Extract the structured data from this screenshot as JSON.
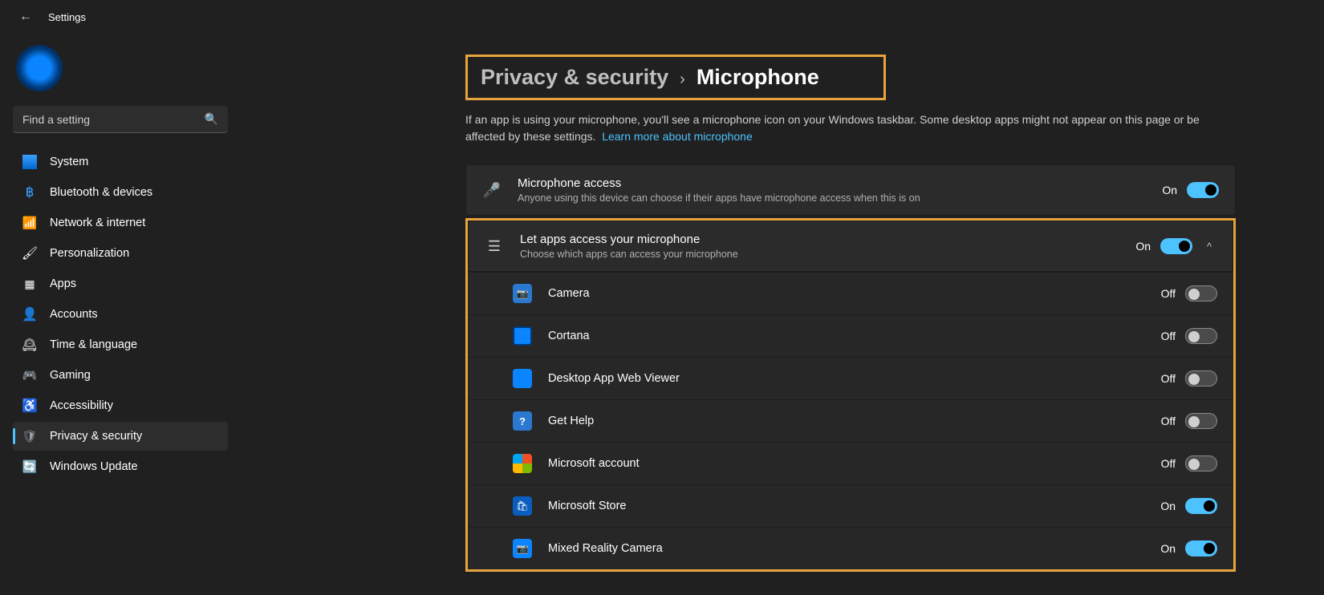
{
  "window": {
    "title": "Settings"
  },
  "search": {
    "placeholder": "Find a setting"
  },
  "sidebar": {
    "items": [
      {
        "label": "System"
      },
      {
        "label": "Bluetooth & devices"
      },
      {
        "label": "Network & internet"
      },
      {
        "label": "Personalization"
      },
      {
        "label": "Apps"
      },
      {
        "label": "Accounts"
      },
      {
        "label": "Time & language"
      },
      {
        "label": "Gaming"
      },
      {
        "label": "Accessibility"
      },
      {
        "label": "Privacy & security"
      },
      {
        "label": "Windows Update"
      }
    ]
  },
  "breadcrumb": {
    "parent": "Privacy & security",
    "current": "Microphone"
  },
  "intro": {
    "text": "If an app is using your microphone, you'll see a microphone icon on your Windows taskbar. Some desktop apps might not appear on this page or be affected by these settings.",
    "link": "Learn more about microphone"
  },
  "mic_access": {
    "title": "Microphone access",
    "subtitle": "Anyone using this device can choose if their apps have microphone access when this is on",
    "state_label": "On",
    "state": "on"
  },
  "apps_access": {
    "title": "Let apps access your microphone",
    "subtitle": "Choose which apps can access your microphone",
    "state_label": "On",
    "state": "on"
  },
  "apps": [
    {
      "name": "Camera",
      "state_label": "Off",
      "state": "off",
      "icon": "camera"
    },
    {
      "name": "Cortana",
      "state_label": "Off",
      "state": "off",
      "icon": "cortana"
    },
    {
      "name": "Desktop App Web Viewer",
      "state_label": "Off",
      "state": "off",
      "icon": "desktop"
    },
    {
      "name": "Get Help",
      "state_label": "Off",
      "state": "off",
      "icon": "gethelp"
    },
    {
      "name": "Microsoft account",
      "state_label": "Off",
      "state": "off",
      "icon": "msacct"
    },
    {
      "name": "Microsoft Store",
      "state_label": "On",
      "state": "on",
      "icon": "store"
    },
    {
      "name": "Mixed Reality Camera",
      "state_label": "On",
      "state": "on",
      "icon": "mixed"
    }
  ]
}
